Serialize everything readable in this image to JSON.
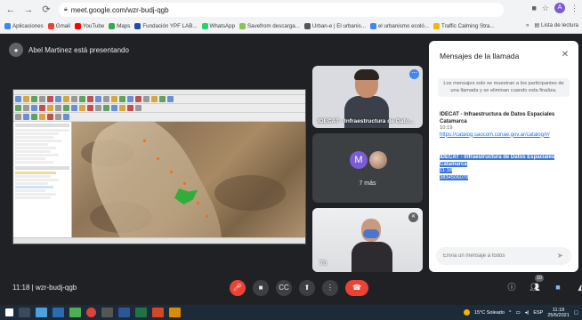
{
  "browser": {
    "url": "meet.google.com/wzr-budj-qgb",
    "bookmarks": [
      "Aplicaciones",
      "Gmail",
      "YouTube",
      "Maps",
      "Fundación YPF LAB...",
      "WhatsApp",
      "Savefrom descarga...",
      "Urban-e | El urbanis...",
      "el urbanismo ecoló...",
      "Traffic Calming Stra..."
    ],
    "bookmarks_more": "»",
    "reading_list": "Lista de lectura",
    "profile_letter": "A"
  },
  "meet": {
    "presenting_text": "Abel Martinez está presentando",
    "tile_name": "IDECAT - Infraestructura de Dato...",
    "avatar_letter": "M",
    "more_count": "7 más",
    "self_label": "Tú",
    "meeting_time": "11:18",
    "meeting_code": "wzr-budj-qgb",
    "people_badge": "10"
  },
  "chat": {
    "title": "Mensajes de la llamada",
    "notice": "Los mensajes solo se muestran a los participantes de una llamada y se eliminan cuando esta finaliza.",
    "messages": [
      {
        "sender": "IDECAT - Infraestructura de Datos Espaciales Catamarca",
        "time": "10:19",
        "link": "https://catalog.saocom.conae.gov.ar/catalog/#/"
      },
      {
        "sender": "IDECAT - Infraestructura de Datos Espaciales Catamarca",
        "time": "11:18",
        "text": "3834506079"
      }
    ],
    "input_placeholder": "Envía un mensaje a todos"
  },
  "taskbar": {
    "weather": "15°C Soleado",
    "lang": "ESP",
    "time": "11:18",
    "date": "25/5/2021"
  },
  "colors": {
    "meet_bg": "#202124",
    "hangup": "#ea4335",
    "accent": "#1a73e8",
    "highlight": "#3b77d8"
  }
}
